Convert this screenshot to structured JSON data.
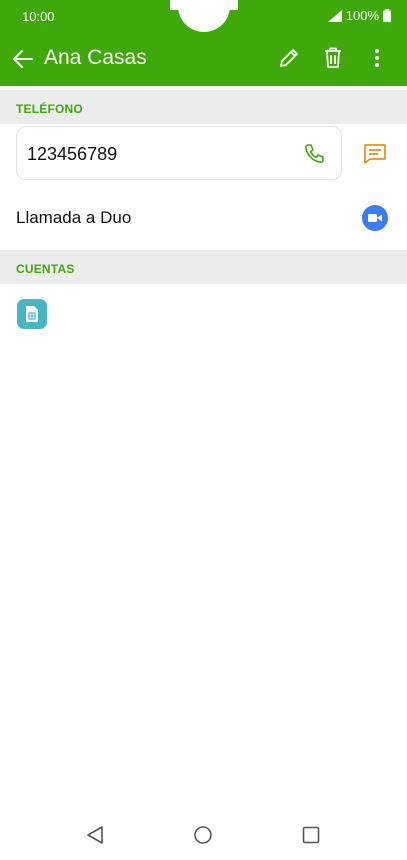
{
  "status_bar": {
    "time": "10:00",
    "battery": "100%"
  },
  "toolbar": {
    "title": "Ana Casas",
    "icons": [
      "back-arrow-icon",
      "edit-pencil-icon",
      "delete-trash-icon",
      "more-options-icon"
    ]
  },
  "sections": {
    "phone_header": "TELÉFONO",
    "accounts_header": "CUENTAS"
  },
  "phone": {
    "number": "123456789"
  },
  "duo": {
    "label": "Llamada a Duo"
  },
  "colors": {
    "accent": "#3fa90b",
    "message_icon": "#e0901a",
    "duo_blue": "#3b7cf0",
    "sim_teal": "#46b6c5"
  }
}
